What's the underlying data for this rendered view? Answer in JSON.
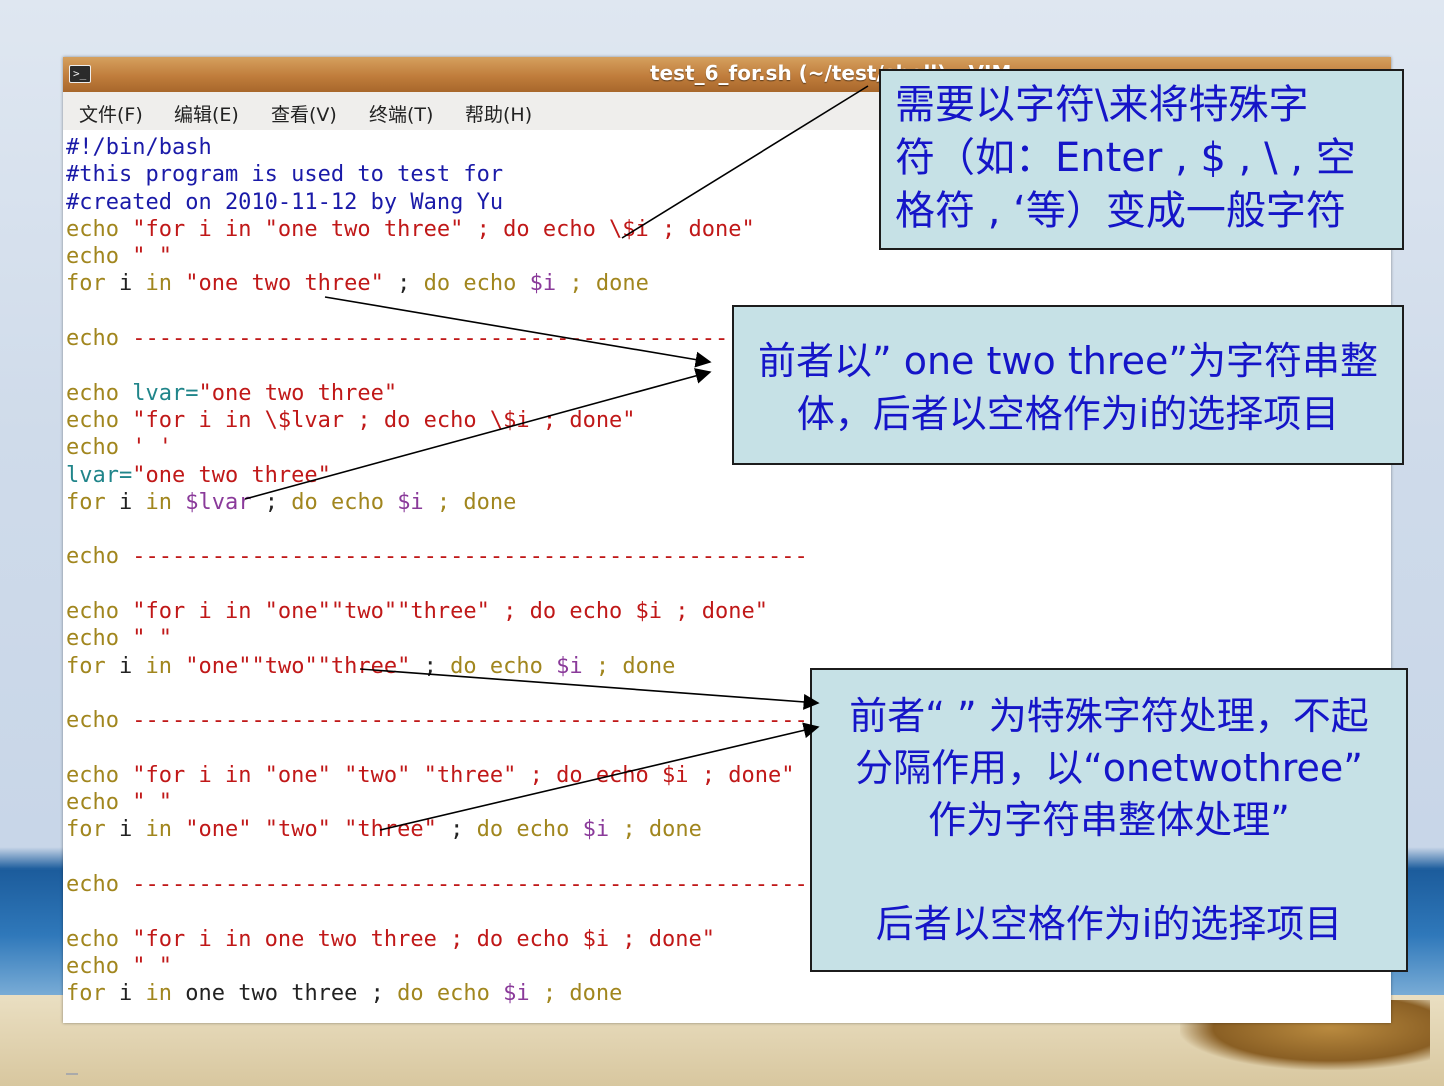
{
  "window": {
    "title": "test_6_for.sh (~/test/shell) - VIM",
    "menu": [
      "文件(F)",
      "编辑(E)",
      "查看(V)",
      "终端(T)",
      "帮助(H)"
    ]
  },
  "code_lines": [
    [
      [
        "c",
        "#!/bin/bash"
      ]
    ],
    [
      [
        "c",
        "#this program is used to test for"
      ]
    ],
    [
      [
        "c",
        "#created on 2010-11-12 by Wang Yu"
      ]
    ],
    [
      [
        "k",
        "echo "
      ],
      [
        "s",
        "\"for i in \"one two three\" ; do echo \\$i ; done\""
      ]
    ],
    [
      [
        "k",
        "echo "
      ],
      [
        "s",
        "\" \""
      ]
    ],
    [
      [
        "k",
        "for "
      ],
      [
        "n",
        "i "
      ],
      [
        "k",
        "in "
      ],
      [
        "s",
        "\"one two three\""
      ],
      [
        "n",
        " ; "
      ],
      [
        "k",
        "do echo "
      ],
      [
        "v",
        "$i"
      ],
      [
        "k",
        " ; done"
      ]
    ],
    [],
    [
      [
        "k",
        "echo "
      ],
      [
        "s",
        "---------------------------------------------------"
      ]
    ],
    [],
    [
      [
        "k",
        "echo "
      ],
      [
        "t",
        "lvar="
      ],
      [
        "s",
        "\"one two three\""
      ]
    ],
    [
      [
        "k",
        "echo "
      ],
      [
        "s",
        "\"for i in \\$lvar ; do echo \\$i ; done\""
      ]
    ],
    [
      [
        "k",
        "echo "
      ],
      [
        "s",
        "' '"
      ]
    ],
    [
      [
        "t",
        "lvar="
      ],
      [
        "s",
        "\"one two three\""
      ]
    ],
    [
      [
        "k",
        "for "
      ],
      [
        "n",
        "i "
      ],
      [
        "k",
        "in "
      ],
      [
        "v",
        "$lvar"
      ],
      [
        "n",
        " ; "
      ],
      [
        "k",
        "do echo "
      ],
      [
        "v",
        "$i"
      ],
      [
        "k",
        " ; done"
      ]
    ],
    [],
    [
      [
        "k",
        "echo "
      ],
      [
        "s",
        "---------------------------------------------------"
      ]
    ],
    [],
    [
      [
        "k",
        "echo "
      ],
      [
        "s",
        "\"for i in \"one\"\"two\"\"three\" ; do echo $i ; done\""
      ]
    ],
    [
      [
        "k",
        "echo "
      ],
      [
        "s",
        "\" \""
      ]
    ],
    [
      [
        "k",
        "for "
      ],
      [
        "n",
        "i "
      ],
      [
        "k",
        "in "
      ],
      [
        "s",
        "\"one\"\"two\"\"three\""
      ],
      [
        "n",
        " ; "
      ],
      [
        "k",
        "do echo "
      ],
      [
        "v",
        "$i"
      ],
      [
        "k",
        " ; done"
      ]
    ],
    [],
    [
      [
        "k",
        "echo "
      ],
      [
        "s",
        "---------------------------------------------------"
      ]
    ],
    [],
    [
      [
        "k",
        "echo "
      ],
      [
        "s",
        "\"for i in \"one\" \"two\" \"three\" ; do echo $i ; done\""
      ]
    ],
    [
      [
        "k",
        "echo "
      ],
      [
        "s",
        "\" \""
      ]
    ],
    [
      [
        "k",
        "for "
      ],
      [
        "n",
        "i "
      ],
      [
        "k",
        "in "
      ],
      [
        "s",
        "\"one\" \"two\" \"three\""
      ],
      [
        "n",
        " ; "
      ],
      [
        "k",
        "do echo "
      ],
      [
        "v",
        "$i"
      ],
      [
        "k",
        " ; done"
      ]
    ],
    [],
    [
      [
        "k",
        "echo "
      ],
      [
        "s",
        "---------------------------------------------------"
      ]
    ],
    [],
    [
      [
        "k",
        "echo "
      ],
      [
        "s",
        "\"for i in one two three ; do echo $i ; done\""
      ]
    ],
    [
      [
        "k",
        "echo "
      ],
      [
        "s",
        "\" \""
      ]
    ],
    [
      [
        "k",
        "for "
      ],
      [
        "n",
        "i "
      ],
      [
        "k",
        "in "
      ],
      [
        "n",
        "one two three"
      ],
      [
        "n",
        " ; "
      ],
      [
        "k",
        "do echo "
      ],
      [
        "v",
        "$i"
      ],
      [
        "k",
        " ; done"
      ]
    ]
  ],
  "callouts": {
    "c1": [
      "需要以字符\\来将特殊字",
      "符（如：Enter , $ , \\ , 空",
      "格符 , ‘等）变成一般字符"
    ],
    "c2": [
      "前者以” one two three”为字符串整",
      "体，后者以空格作为i的选择项目"
    ],
    "c3": [
      "前者“ ” 为特殊字符处理，不起",
      "分隔作用，以“onetwothree”",
      "作为字符串整体处理”",
      "",
      "后者以空格作为i的选择项目"
    ]
  },
  "colors": {
    "keyword": "#a1861e",
    "string": "#c01818",
    "comment": "#1a1aa8",
    "variable": "#8a3a9a",
    "assignment": "#20858a",
    "callout_text": "#1515c8",
    "callout_bg": "#c6e1e6",
    "titlebar": "#c07d3c"
  }
}
